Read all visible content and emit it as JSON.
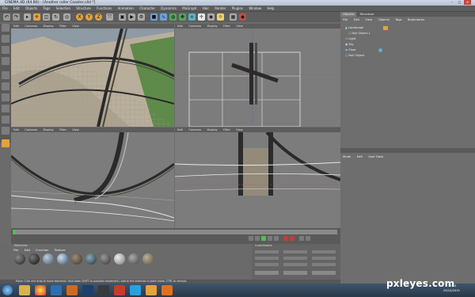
{
  "window": {
    "title": "CINEMA 4D (64 Bit) - [Another roller Coaster.c4d *]",
    "controls": [
      "–",
      "□",
      "✕"
    ]
  },
  "menu": [
    "File",
    "Edit",
    "Objects",
    "Tags",
    "Selection",
    "Structure",
    "Functions",
    "Animation",
    "Character",
    "Dynamics",
    "MoGraph",
    "Hair",
    "Render",
    "Plugins",
    "Window",
    "Help"
  ],
  "viewport_menu": [
    "Edit",
    "Cameras",
    "Display",
    "Filter",
    "View"
  ],
  "object_manager": {
    "tabs": [
      "Objects",
      "Structure"
    ],
    "menu": [
      "File",
      "Edit",
      "View",
      "Objects",
      "Tags",
      "Bookmarks"
    ],
    "objects": [
      "Landscape",
      "Null Object.1",
      "Light",
      "Sky",
      "Floor",
      "Null Object"
    ]
  },
  "attributes": {
    "menu": [
      "Mode",
      "Edit",
      "User Data"
    ]
  },
  "material_manager": {
    "title": "Materials",
    "menu": [
      "File",
      "Edit",
      "Function",
      "Texture"
    ]
  },
  "coordinates": {
    "title": "Coordinates"
  },
  "status": {
    "text": "Move: Click and drag to move elements. Hold down SHIFT to quantize movement / add to the selection in point mode, CTRL to remove."
  },
  "taskbar": {
    "time": "15:14",
    "date": "29/10/2010"
  },
  "watermark": "pxleyes.com",
  "icons": {
    "move": "move-icon",
    "scale": "scale-icon",
    "rotate": "rotate-icon",
    "x": "X",
    "y": "Y",
    "z": "Z"
  },
  "colors": {
    "viewport": "#7c7c7c",
    "panel": "#6b6b6b",
    "accent": "#e6a23c"
  }
}
